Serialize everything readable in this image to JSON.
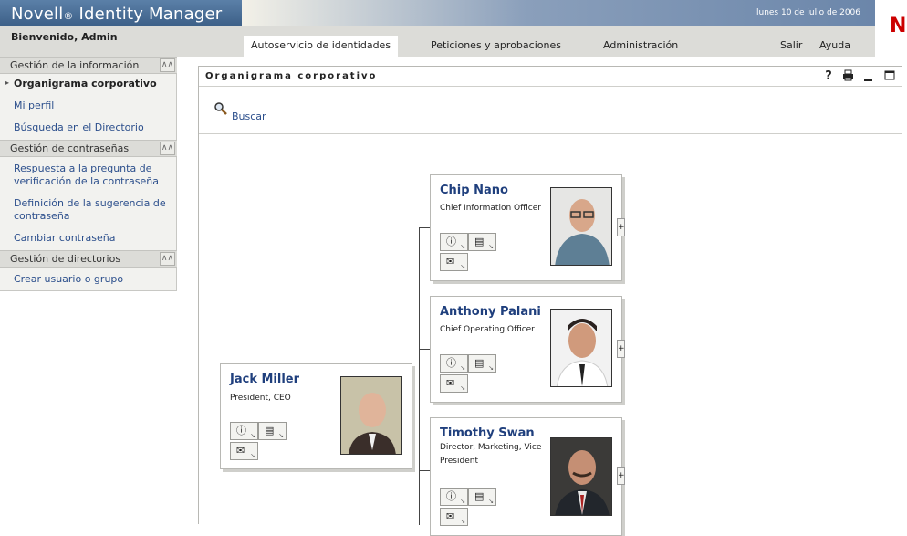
{
  "header": {
    "app_name": "Novell",
    "reg_mark": "®",
    "app_product": "Identity Manager",
    "date": "lunes 10 de julio de 2006",
    "logo_letter": "N",
    "welcome": "Bienvenido, Admin",
    "brand_color": "#3c5f87",
    "logo_color": "#cc0000"
  },
  "nav": {
    "tabs": [
      {
        "label": "Autoservicio de identidades",
        "active": true
      },
      {
        "label": "Peticiones y aprobaciones",
        "active": false
      },
      {
        "label": "Administración",
        "active": false
      }
    ],
    "right": [
      "Salir",
      "Ayuda"
    ]
  },
  "sidebar": {
    "sections": [
      {
        "title": "Gestión de la información",
        "items": [
          "Organigrama corporativo",
          "Mi perfil",
          "Búsqueda en el Directorio"
        ]
      },
      {
        "title": "Gestión de contraseñas",
        "items": [
          "Respuesta a la pregunta de verificación de la contraseña",
          "Definición de la sugerencia de contraseña",
          "Cambiar contraseña"
        ]
      },
      {
        "title": "Gestión de directorios",
        "items": [
          "Crear usuario o grupo"
        ]
      }
    ],
    "current_item": "Organigrama corporativo",
    "collapse_icon": "chevron-double-up-icon"
  },
  "portlet": {
    "title": "Organigrama corporativo",
    "controls": [
      "help-icon",
      "print-icon",
      "minimize-icon",
      "maximize-icon"
    ],
    "search_label": "Buscar"
  },
  "org_chart": {
    "root": {
      "name": "Jack Miller",
      "title": "President, CEO"
    },
    "reports": [
      {
        "name": "Chip Nano",
        "title": "Chief Information Officer"
      },
      {
        "name": "Anthony Palani",
        "title": "Chief Operating Officer"
      },
      {
        "name": "Timothy Swan",
        "title": "Director, Marketing, Vice President"
      }
    ],
    "actions": [
      "info-icon",
      "org-chart-icon",
      "email-icon"
    ],
    "expand_label": "+"
  }
}
